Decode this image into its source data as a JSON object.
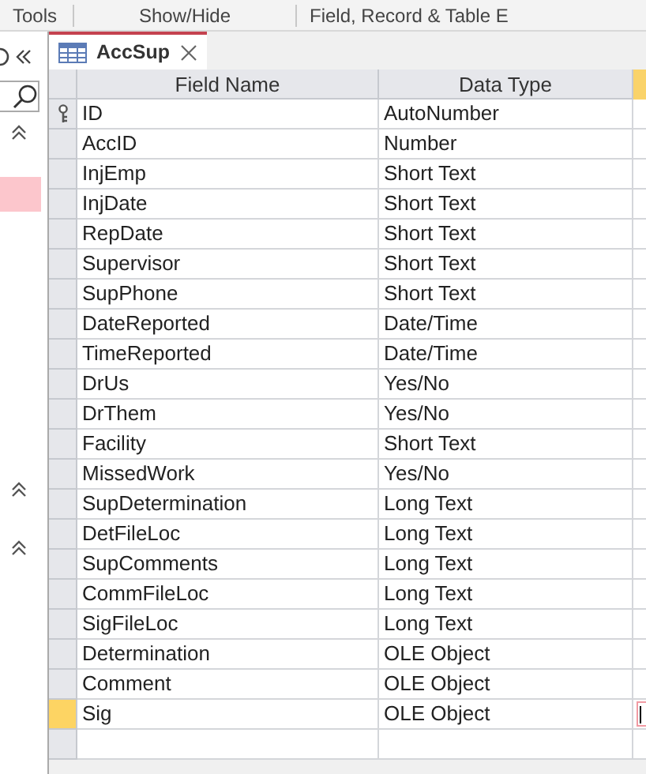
{
  "ribbon_groups": [
    "Tools",
    "Show/Hide",
    "Field, Record & Table E"
  ],
  "nav_pane": {
    "sections": [
      {
        "expanded": true
      },
      {
        "expanded": true
      },
      {
        "expanded": true
      }
    ]
  },
  "tab": {
    "title": "AccSup",
    "selected": true
  },
  "table": {
    "columns": [
      "Field Name",
      "Data Type"
    ],
    "rows": [
      {
        "field": "ID",
        "type": "AutoNumber",
        "primary_key": true,
        "selected": false
      },
      {
        "field": "AccID",
        "type": "Number",
        "primary_key": false,
        "selected": false
      },
      {
        "field": "InjEmp",
        "type": "Short Text",
        "primary_key": false,
        "selected": false
      },
      {
        "field": "InjDate",
        "type": "Short Text",
        "primary_key": false,
        "selected": false
      },
      {
        "field": "RepDate",
        "type": "Short Text",
        "primary_key": false,
        "selected": false
      },
      {
        "field": "Supervisor",
        "type": "Short Text",
        "primary_key": false,
        "selected": false
      },
      {
        "field": "SupPhone",
        "type": "Short Text",
        "primary_key": false,
        "selected": false
      },
      {
        "field": "DateReported",
        "type": "Date/Time",
        "primary_key": false,
        "selected": false
      },
      {
        "field": "TimeReported",
        "type": "Date/Time",
        "primary_key": false,
        "selected": false
      },
      {
        "field": "DrUs",
        "type": "Yes/No",
        "primary_key": false,
        "selected": false
      },
      {
        "field": "DrThem",
        "type": "Yes/No",
        "primary_key": false,
        "selected": false
      },
      {
        "field": "Facility",
        "type": "Short Text",
        "primary_key": false,
        "selected": false
      },
      {
        "field": "MissedWork",
        "type": "Yes/No",
        "primary_key": false,
        "selected": false
      },
      {
        "field": "SupDetermination",
        "type": "Long Text",
        "primary_key": false,
        "selected": false
      },
      {
        "field": "DetFileLoc",
        "type": "Long Text",
        "primary_key": false,
        "selected": false
      },
      {
        "field": "SupComments",
        "type": "Long Text",
        "primary_key": false,
        "selected": false
      },
      {
        "field": "CommFileLoc",
        "type": "Long Text",
        "primary_key": false,
        "selected": false
      },
      {
        "field": "SigFileLoc",
        "type": "Long Text",
        "primary_key": false,
        "selected": false
      },
      {
        "field": "Determination",
        "type": "OLE Object",
        "primary_key": false,
        "selected": false
      },
      {
        "field": "Comment",
        "type": "OLE Object",
        "primary_key": false,
        "selected": false
      },
      {
        "field": "Sig",
        "type": "OLE Object",
        "primary_key": false,
        "selected": true
      }
    ]
  }
}
